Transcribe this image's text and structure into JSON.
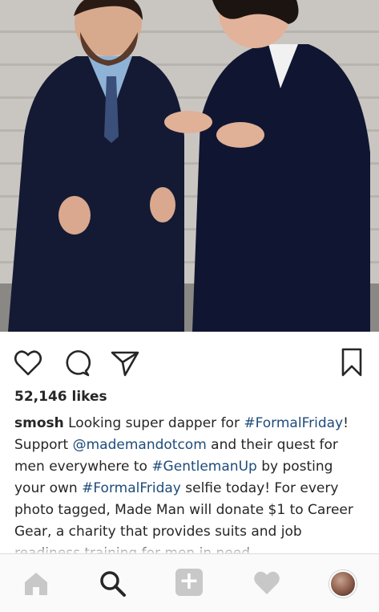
{
  "post": {
    "image": {
      "description_icon": "photo-icon"
    },
    "likes": "52,146 likes",
    "caption": {
      "username": "smosh",
      "seg1": " Looking super dapper for ",
      "tag1": "#FormalFriday",
      "seg2": "! Support ",
      "mention": "@mademandotcom",
      "seg3": " and their quest for men everywhere to ",
      "tag2": "#GentlemanUp",
      "seg4": " by posting your own ",
      "tag3": "#FormalFriday",
      "seg5": " selfie today! For every photo tagged, Made Man will donate $1 to Career Gear, a charity that provides suits and job readiness training for men in need."
    },
    "actions": [
      "heart-icon",
      "comment-icon",
      "share-icon",
      "bookmark-icon"
    ]
  },
  "nav": {
    "items": [
      "home-icon",
      "search-icon",
      "add-icon",
      "activity-heart-icon",
      "profile-avatar"
    ],
    "add_label": "+"
  },
  "colors": {
    "tag": "#1e4b7a",
    "text": "#262626",
    "inactive_icon": "#c8c8c8"
  }
}
